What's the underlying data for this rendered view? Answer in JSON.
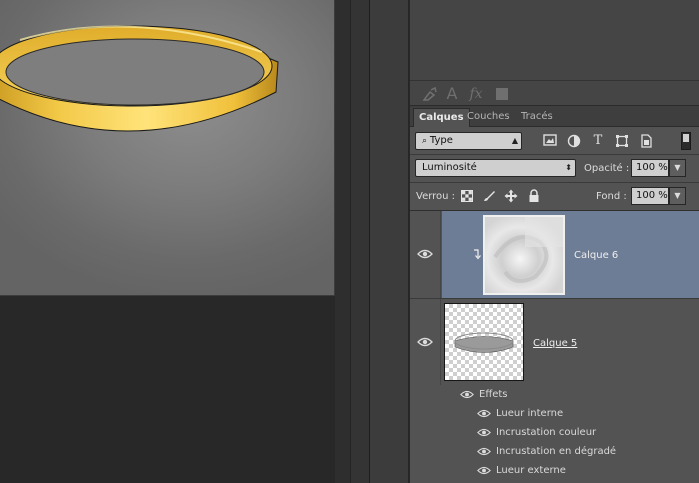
{
  "properties_toolbar": {
    "icons": [
      "brush-preset-icon",
      "type-icon",
      "fx-icon",
      "color-swatch-icon"
    ],
    "glyph_a": "A",
    "glyph_fx": "fx"
  },
  "layers_panel": {
    "tabs": [
      {
        "label": "Calques",
        "active": true
      },
      {
        "label": "Couches",
        "active": false
      },
      {
        "label": "Tracés",
        "active": false
      }
    ],
    "filter_kind": "Type",
    "blend_mode": "Luminosité",
    "opacity_label": "Opacité :",
    "opacity_value": "100 %",
    "lock_label": "Verrou :",
    "fill_label": "Fond :",
    "fill_value": "100 %",
    "layers": [
      {
        "name": "Calque 6",
        "visible": true,
        "selected": true,
        "clipped": true
      },
      {
        "name": "Calque 5",
        "visible": true,
        "selected": false,
        "clipped": false
      }
    ],
    "effects_label": "Effets",
    "effects": [
      "Lueur interne",
      "Incrustation couleur",
      "Incrustation en dégradé",
      "Lueur externe"
    ]
  },
  "colors": {
    "selected_layer_bg": "#6e7d96",
    "panel_bg": "#535353",
    "ring_gold": "#f2c53a"
  }
}
